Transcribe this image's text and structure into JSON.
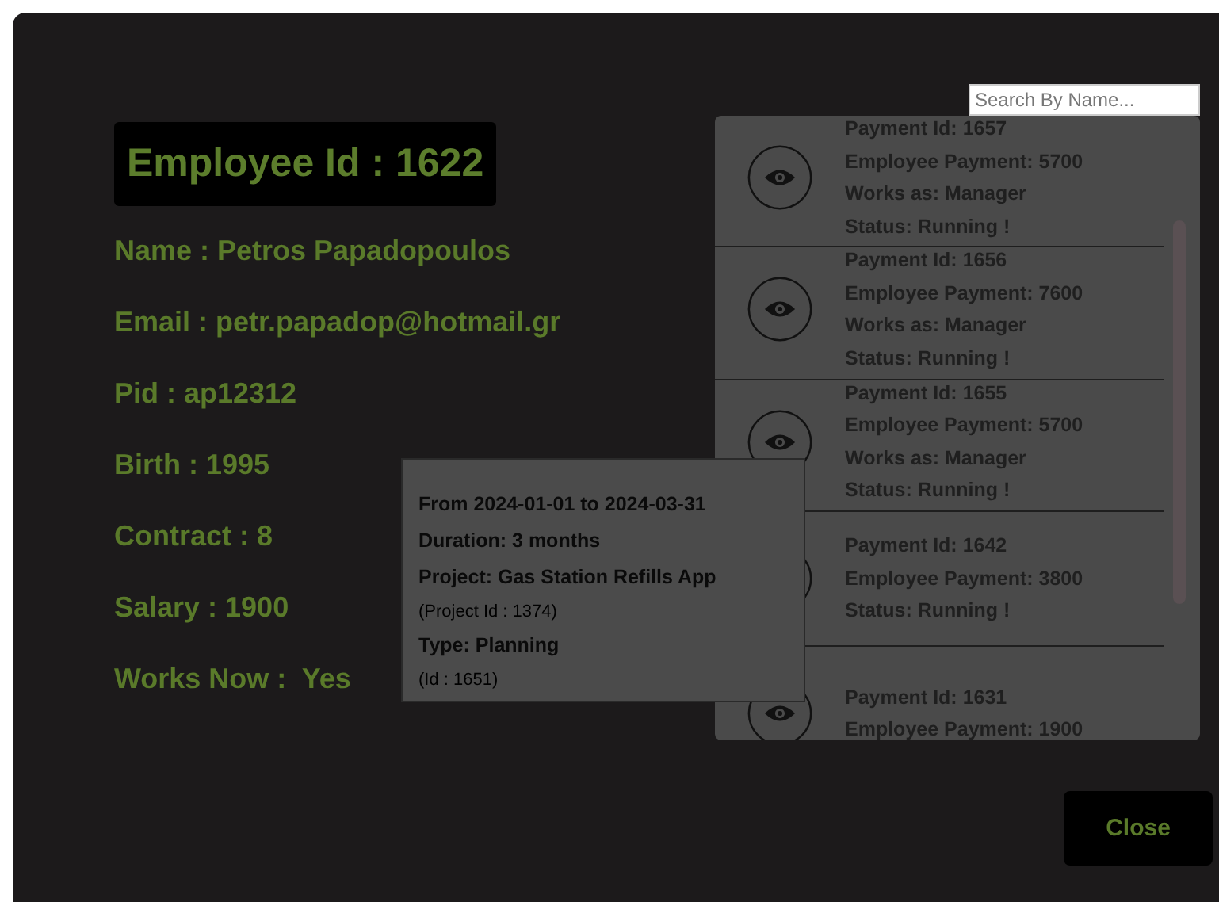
{
  "search": {
    "placeholder": "Search By Name..."
  },
  "employee": {
    "heading": "Employee Id : 1622",
    "fields": [
      "Name : Petros Papadopoulos",
      "Email : petr.papadop@hotmail.gr",
      "Pid : ap12312",
      "Birth : 1995",
      "Contract : 8",
      "Salary : 1900",
      "Works Now :  Yes"
    ]
  },
  "payments": [
    {
      "lines": [
        "Payment Id: 1657",
        "Employee Payment: 5700",
        "Works as: Manager",
        "Status: Running !"
      ]
    },
    {
      "lines": [
        "Payment Id: 1656",
        "Employee Payment: 7600",
        "Works as: Manager",
        "Status: Running !"
      ]
    },
    {
      "lines": [
        "Payment Id: 1655",
        "Employee Payment: 5700",
        "Works as: Manager",
        "Status: Running !"
      ]
    },
    {
      "lines": [
        "Payment Id: 1642",
        "Employee Payment: 3800",
        "Status: Running !"
      ]
    },
    {
      "lines": [
        "Payment Id: 1631",
        "Employee Payment: 1900"
      ]
    }
  ],
  "tooltip": [
    {
      "kind": "main",
      "text": "From 2024-01-01 to 2024-03-31"
    },
    {
      "kind": "main",
      "text": "Duration: 3 months"
    },
    {
      "kind": "main",
      "text": "Project: Gas Station Refills App"
    },
    {
      "kind": "note",
      "text": "(Project Id : 1374)"
    },
    {
      "kind": "main",
      "text": "Type: Planning"
    },
    {
      "kind": "note",
      "text": "(Id : 1651)"
    }
  ],
  "close_button": "Close"
}
